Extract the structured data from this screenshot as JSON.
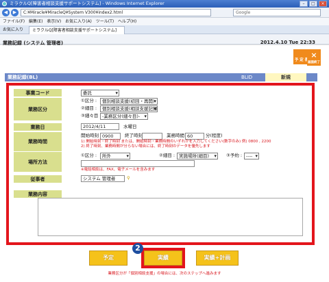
{
  "window": {
    "title": "ミラクルQ[障害者相談支援サポートシステム] - Windows Internet Explorer",
    "minimize": "–",
    "maximize": "□",
    "close": "×"
  },
  "browser": {
    "address": "C:¥Miracle¥MiracleQ¥System V300¥index2.html",
    "search_placeholder": "Google",
    "menu": "ファイル(F)  編集(E)  表示(V)  お気に入り(A)  ツール(T)  ヘルプ(H)",
    "favorites": "お気に入り",
    "tab_title": "ミラクルQ[障害者相談支援サポートシステム]"
  },
  "header": {
    "title": "業務記録 (システム 管理者)",
    "datetime": "2012.4.10 Tue 22:33",
    "schedule_label": "予 定 表",
    "close_icon": "×",
    "close_label": "画面終了"
  },
  "section": {
    "title": "業務記録(BL)",
    "bid_label": "BLID",
    "status": "新規"
  },
  "form": {
    "business_code": {
      "label": "事業コード",
      "value": "委託"
    },
    "business_category": {
      "label": "業務区分",
      "rows": [
        {
          "prefix": "①区分 :",
          "value": "個別相談支援(初回・再開)"
        },
        {
          "prefix": "②細目 :",
          "value": "個別相談支援(相談支援記録)"
        },
        {
          "prefix": "③細々目 :",
          "value": "-業務区分(細々目)-"
        }
      ]
    },
    "business_date": {
      "label": "業務日",
      "value": "2012/4/11",
      "weekday": "水曜日"
    },
    "business_time": {
      "label": "業務時間",
      "start_label": "開始時刻",
      "start_value": "0900",
      "end_label": "終了時刻",
      "end_value": "",
      "duration_label": "業務時間",
      "duration_value": "60",
      "unit": "分(程度)",
      "note1": "1) 開始時刻・終了時刻 または、開始時刻・業務時間のいずれかを入力してください(数字のみ) 例) 0800 , 2200",
      "note2": "2) 終了時刻、業務時間が分らない場合には、終了時刻のデータを優先します"
    },
    "place_method": {
      "label": "場所方法",
      "cat_prefix": "①区分 :",
      "cat_value": "所外",
      "detail_prefix": "②細目 :",
      "detail_value": "実施場所(細目)",
      "subdetail_prefix": "③予約 :",
      "subdetail_value": "----",
      "note": "※電話相談は、FAX、電子メールを含みます"
    },
    "staff": {
      "label": "従事者",
      "value": "システム 管理者"
    },
    "content": {
      "label": "業務内容",
      "value": ""
    }
  },
  "buttons": {
    "schedule": "予定",
    "record": "実績",
    "record_plan": "実績+計画"
  },
  "callout": {
    "number": "2"
  },
  "footer_note": "業務区分が「個別相談支援」の場合には、次のステップへ進みます"
}
